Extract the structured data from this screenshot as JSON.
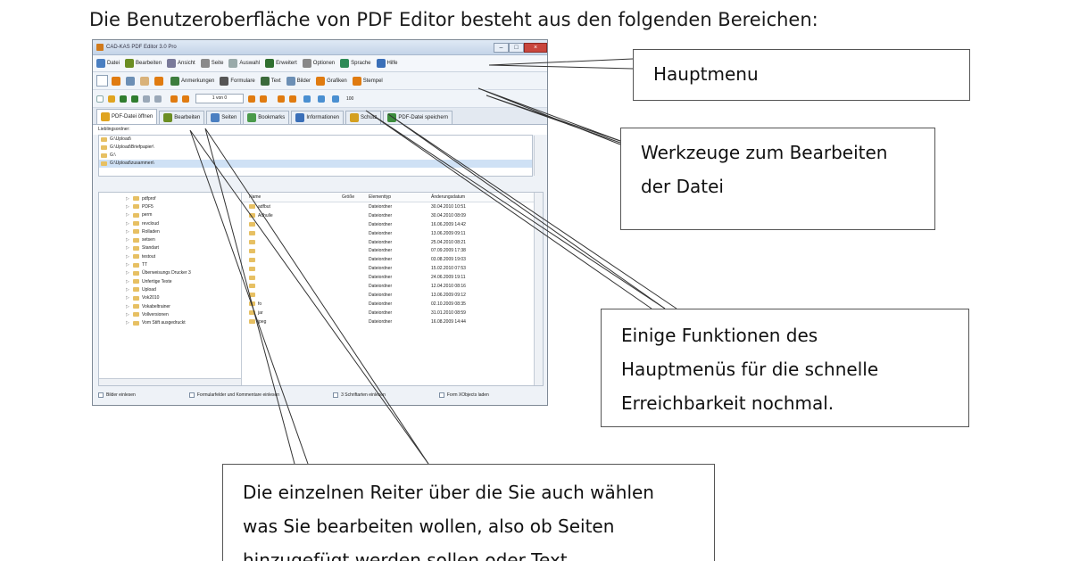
{
  "heading": "Die Benutzeroberfläche von PDF Editor besteht aus den folgenden Bereichen:",
  "window": {
    "title": "CAD-KAS PDF Editor 3.0 Pro",
    "controls": {
      "minimize": "–",
      "maximize": "□",
      "close": "×"
    }
  },
  "menu": [
    {
      "label": "Datei",
      "icon": "file-icon",
      "color": "#4a7fc1"
    },
    {
      "label": "Bearbeiten",
      "icon": "pencil-icon",
      "color": "#6b8e23"
    },
    {
      "label": "Ansicht",
      "icon": "view-icon",
      "color": "#7a7a9a"
    },
    {
      "label": "Seite",
      "icon": "page-icon",
      "color": "#8a8a8a"
    },
    {
      "label": "Auswahl",
      "icon": "select-icon",
      "color": "#9aa"
    },
    {
      "label": "Erweitert",
      "icon": "extend-icon",
      "color": "#2f6f2f"
    },
    {
      "label": "Optionen",
      "icon": "options-icon",
      "color": "#888"
    },
    {
      "label": "Sprache",
      "icon": "globe-icon",
      "color": "#2e8b57"
    },
    {
      "label": "Hilfe",
      "icon": "help-icon",
      "color": "#3a6fb8"
    }
  ],
  "toolbar1": [
    {
      "label": "Anmerkungen",
      "icon": "annotation-icon",
      "color": "#3d7d3d"
    },
    {
      "label": "Formulare",
      "icon": "form-icon",
      "color": "#555"
    },
    {
      "label": "Text",
      "icon": "text-icon",
      "color": "#3b6a3b"
    },
    {
      "label": "Bilder",
      "icon": "image-icon",
      "color": "#6c8fb5"
    },
    {
      "label": "Grafiken",
      "icon": "graphics-icon",
      "color": "#e07b10"
    },
    {
      "label": "Stempel",
      "icon": "stamp-icon",
      "color": "#e07b10"
    }
  ],
  "toolbar2": {
    "page_indicator": "1 von 0",
    "zoom": "100"
  },
  "tabs": [
    {
      "label": "PDF-Datei öffnen",
      "icon": "open-folder-icon",
      "color": "#e0a420"
    },
    {
      "label": "Bearbeiten",
      "icon": "edit-icon",
      "color": "#6b8e23"
    },
    {
      "label": "Seiten",
      "icon": "pages-icon",
      "color": "#4a7fc1"
    },
    {
      "label": "Bookmarks",
      "icon": "bookmark-icon",
      "color": "#4a9a4a"
    },
    {
      "label": "Informationen",
      "icon": "info-icon",
      "color": "#3a6fb8"
    },
    {
      "label": "Schutz",
      "icon": "key-icon",
      "color": "#d4a020"
    },
    {
      "label": "PDF-Datei speichern",
      "icon": "save-icon",
      "color": "#3d8d3d"
    }
  ],
  "recent_label": "Lieblingsordner:",
  "recent_folders": [
    "G:\\Upload\\",
    "G:\\Upload\\Briefpapier\\",
    "G:\\",
    "G:\\Upload\\zusammen\\"
  ],
  "tree": [
    "pdfprof",
    "PDF5",
    "perm",
    "revcloud",
    "Rolladen",
    "setsen",
    "Standart",
    "testout",
    "TT",
    "Überweisungs Drucker 3",
    "Unfertige Texte",
    "Upload",
    "Vok2010",
    "Vokabeltrainer",
    "Vollversionen",
    "Vom Stift ausgedruckt"
  ],
  "columns": {
    "name": "Name",
    "size": "Größe",
    "type": "Elementtyp",
    "date": "Änderungsdatum"
  },
  "rows": [
    {
      "name": "adfbut",
      "type": "Dateiordner",
      "date": "30.04.2010 10:51"
    },
    {
      "name": "Adhulle",
      "type": "Dateiordner",
      "date": "30.04.2010 08:09"
    },
    {
      "name": "",
      "type": "Dateiordner",
      "date": "16.06.2009 14:42"
    },
    {
      "name": "",
      "type": "Dateiordner",
      "date": "13.06.2009 09:11"
    },
    {
      "name": "",
      "type": "Dateiordner",
      "date": "25.04.2010 08:21"
    },
    {
      "name": "",
      "type": "Dateiordner",
      "date": "07.09.2009 17:38"
    },
    {
      "name": "",
      "type": "Dateiordner",
      "date": "03.08.2009 19:03"
    },
    {
      "name": "",
      "type": "Dateiordner",
      "date": "15.02.2010 07:53"
    },
    {
      "name": "",
      "type": "Dateiordner",
      "date": "24.06.2009 19:11"
    },
    {
      "name": "",
      "type": "Dateiordner",
      "date": "12.04.2010 08:16"
    },
    {
      "name": "",
      "type": "Dateiordner",
      "date": "13.06.2009 09:12"
    },
    {
      "name": "fo",
      "type": "Dateiordner",
      "date": "02.10.2009 08:35"
    },
    {
      "name": "jar",
      "type": "Dateiordner",
      "date": "31.01.2010 08:59"
    },
    {
      "name": "jpeg",
      "type": "Dateiordner",
      "date": "16.08.2009 14:44"
    }
  ],
  "status": [
    "Bilder einlesen",
    "Formularfelder und Kommentare einlesen",
    "3 Schriftarten einlesen",
    "Form XObjects laden"
  ],
  "callouts": {
    "hauptmenu": "Hauptmenu",
    "werkzeuge": [
      "Werkzeuge zum Bearbeiten",
      "der Datei"
    ],
    "funktionen": [
      "Einige Funktionen des",
      "Hauptmenüs für die schnelle",
      "Erreichbarkeit nochmal."
    ],
    "reiter": [
      "Die einzelnen Reiter über die Sie auch wählen",
      "was Sie bearbeiten wollen, also ob Seiten",
      "hinzugefügt werden sollen oder Text"
    ]
  }
}
